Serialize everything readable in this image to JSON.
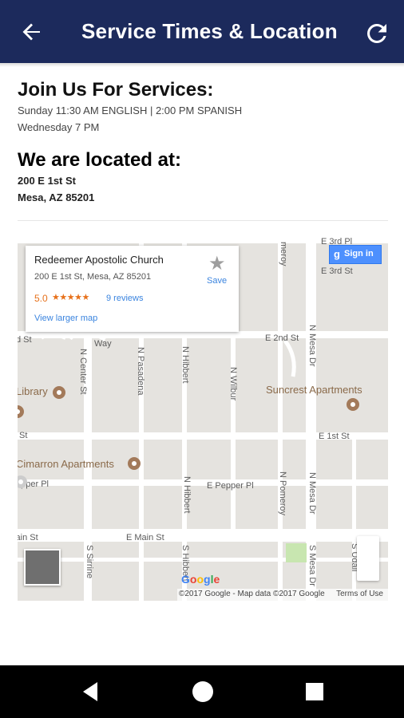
{
  "appbar": {
    "title": "Service Times & Location",
    "back_icon": "arrow-left-icon",
    "refresh_icon": "refresh-icon",
    "bg_color": "#1c2a5c"
  },
  "services": {
    "heading": "Join Us For Services:",
    "lines": [
      "Sunday 11:30 AM ENGLISH | 2:00 PM SPANISH",
      "Wednesday 7 PM"
    ]
  },
  "location": {
    "heading": "We are located at:",
    "lines": [
      "200 E 1st St",
      "Mesa, AZ 85201"
    ]
  },
  "map": {
    "info_card": {
      "name": "Redeemer Apostolic Church",
      "address": "200 E 1st St, Mesa, AZ 85201",
      "rating": "5.0",
      "stars": "★★★★★",
      "reviews": "9 reviews",
      "larger_map": "View larger map",
      "save": "Save"
    },
    "sign_in": "Sign in",
    "street_labels": {
      "e3rd_top": "E 3rd Pl",
      "e3rd": "E 3rd St",
      "e2nd": "E 2nd St",
      "e1st": "E 1st St",
      "st_left_top": "d St",
      "st_left_mid": "St",
      "pepper_left": "epper Pl",
      "pepper": "E Pepper Pl",
      "main_left": "E Main St",
      "main_right": "E Main St",
      "way": "Way",
      "n_center": "N Center St",
      "n_pasadena": "N Pasadena",
      "n_hibbert": "N Hibbert",
      "n_wilbur": "N Wilbur",
      "n_mesa": "N Mesa Dr",
      "n_hibbert2": "N Hibbert",
      "n_pomeroy": "N Pomeroy",
      "s_sirrine": "S Sirrine",
      "s_hibbert": "S Hibbert",
      "s_mesa": "S Mesa Dr",
      "s_udall": "S Udall",
      "meroy": "meroy"
    },
    "pois": {
      "library": "Library",
      "suncrest": "Suncrest Apartments",
      "cimarron": "Cimarron Apartments"
    },
    "google_logo": "Google",
    "attribution": "©2017 Google - Map data ©2017 Google",
    "terms": "Terms of Use"
  },
  "navbar": {
    "back_icon": "triangle-back-icon",
    "home_icon": "circle-home-icon",
    "recents_icon": "square-recents-icon"
  }
}
